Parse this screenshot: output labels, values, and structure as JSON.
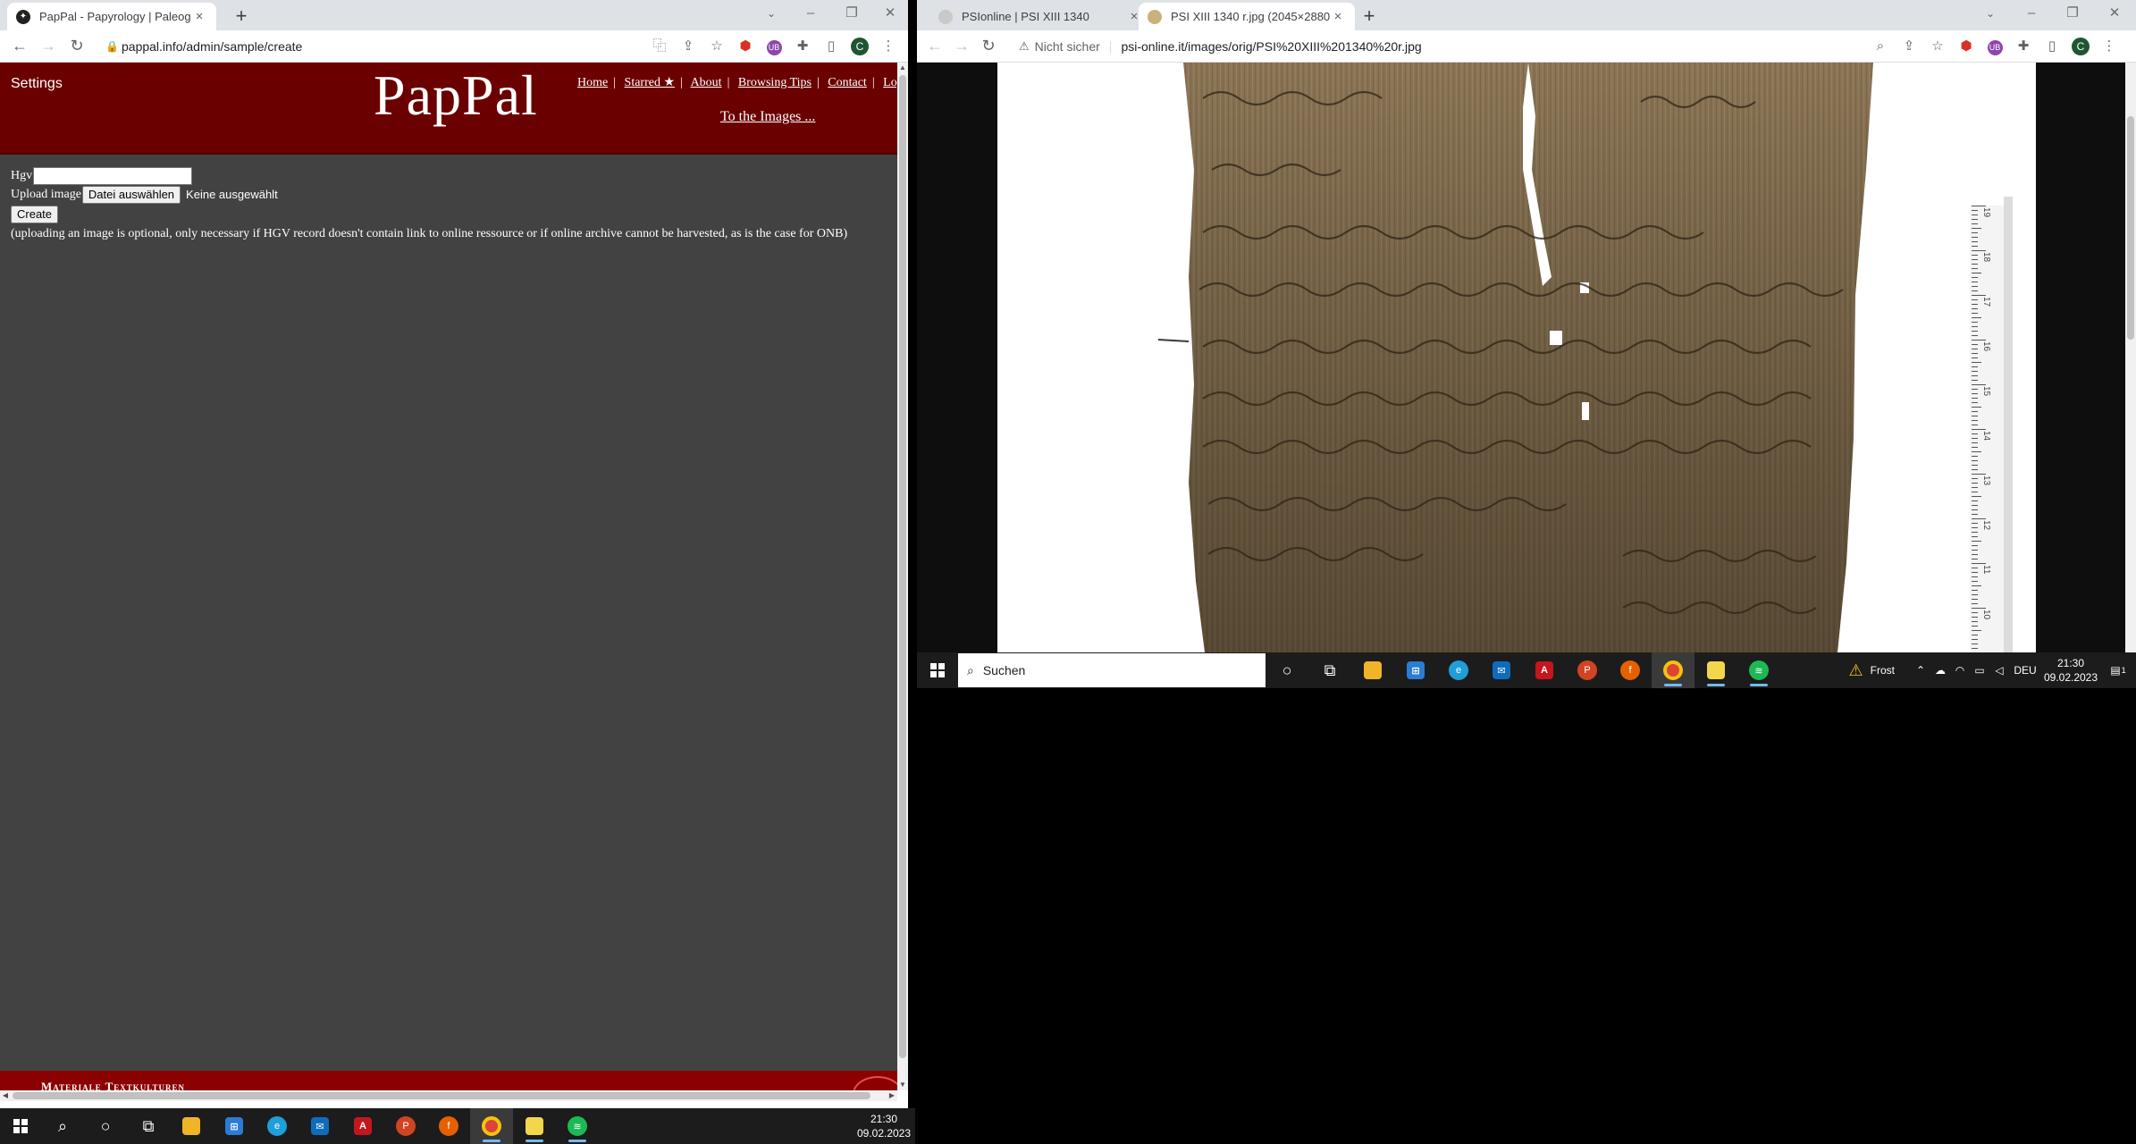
{
  "left_browser": {
    "tabs": [
      {
        "title": "PapPal - Papyrology | Paleograph",
        "close": "×"
      }
    ],
    "new_tab": "+",
    "window_controls": [
      "⌄",
      "–",
      "❐",
      "✕"
    ],
    "url": "pappal.info/admin/sample/create",
    "page": {
      "settings": "Settings",
      "logo": "PapPal",
      "nav": [
        {
          "label": "Home"
        },
        {
          "label": "Starred ★"
        },
        {
          "label": "About"
        },
        {
          "label": "Browsing Tips"
        },
        {
          "label": "Contact"
        },
        {
          "label": "Logou"
        }
      ],
      "images_link": "To the Images ...",
      "form": {
        "hgv_label": "Hgv",
        "hgv_value": "",
        "upload_label": "Upload image",
        "file_button": "Datei auswählen",
        "file_status": "Keine ausgewählt",
        "create_button": "Create",
        "note": "(uploading an image is optional, only necessary if HGV record doesn't contain link to online ressource or if online archive cannot be harvested, as is the case for ONB)"
      },
      "footer_text": "Materiale Textkulturen"
    }
  },
  "right_browser": {
    "tabs": [
      {
        "title": "PSIonline | PSI XIII 1340",
        "close": "×"
      },
      {
        "title": "PSI XIII 1340 r.jpg (2045×2880)",
        "close": "×"
      }
    ],
    "new_tab": "+",
    "window_controls": [
      "⌄",
      "–",
      "❐",
      "✕"
    ],
    "security_label": "Nicht sicher",
    "url": "psi-online.it/images/orig/PSI%20XIII%201340%20r.jpg",
    "ruler_labels": [
      "19",
      "18",
      "17",
      "16",
      "15",
      "14",
      "13",
      "12",
      "11",
      "10"
    ]
  },
  "taskbar_left": {
    "clock_time": "21:30",
    "clock_date": "09.02.2023"
  },
  "taskbar_right": {
    "search_placeholder": "Suchen",
    "weather": "Frost",
    "language": "DEU",
    "clock_time": "21:30",
    "clock_date": "09.02.2023",
    "notification_count": "1"
  },
  "colors": {
    "pappal_header": "#6b0000",
    "pappal_body": "#424242",
    "taskbar": "#1c1c1c",
    "papyrus": "#8a7455"
  }
}
